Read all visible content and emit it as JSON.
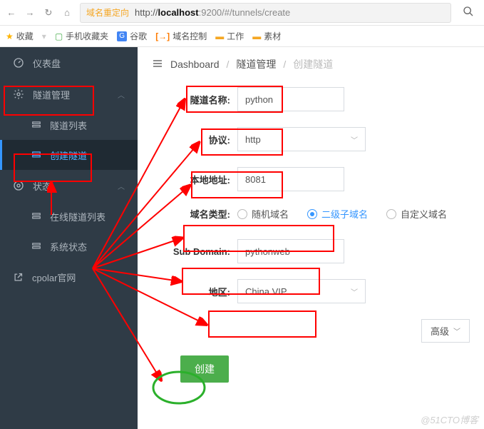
{
  "browser": {
    "url_tag": "域名重定向",
    "url_pre": "http://",
    "url_bold": "localhost",
    "url_tail": ":9200/#/tunnels/create"
  },
  "bookmarks": {
    "fav": "收藏",
    "mobile": "手机收藏夹",
    "google": "谷歌",
    "domain": "域名控制",
    "work": "工作",
    "material": "素材"
  },
  "sidebar": {
    "dashboard": "仪表盘",
    "tunnel_mgmt": "隧道管理",
    "tunnel_list": "隧道列表",
    "tunnel_create": "创建隧道",
    "status": "状态",
    "online_list": "在线隧道列表",
    "sys_status": "系统状态",
    "cpolar": "cpolar官网"
  },
  "crumbs": {
    "a": "Dashboard",
    "b": "隧道管理",
    "c": "创建隧道"
  },
  "form": {
    "name_label": "隧道名称:",
    "name_value": "python",
    "proto_label": "协议:",
    "proto_value": "http",
    "addr_label": "本地地址:",
    "addr_value": "8081",
    "type_label": "域名类型:",
    "type_opts": {
      "random": "随机域名",
      "sub": "二级子域名",
      "custom": "自定义域名"
    },
    "type_selected": "sub",
    "sub_label": "Sub Domain:",
    "sub_value": "pythonweb",
    "region_label": "地区:",
    "region_value": "China VIP",
    "advanced": "高级",
    "create": "创建"
  },
  "watermark": "@51CTO博客"
}
